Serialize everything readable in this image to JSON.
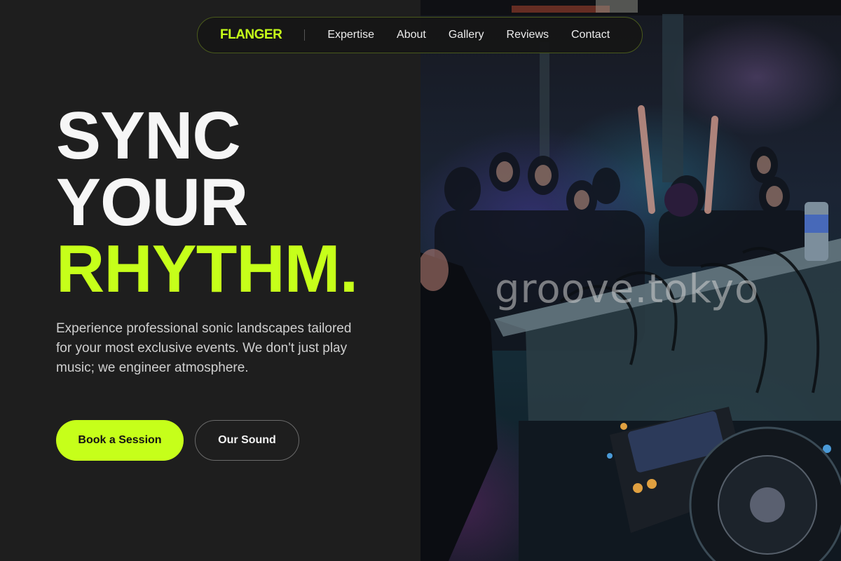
{
  "nav": {
    "brand": "FLANGER",
    "links": [
      "Expertise",
      "About",
      "Gallery",
      "Reviews",
      "Contact"
    ]
  },
  "hero": {
    "headline": [
      "SYNC",
      "YOUR",
      "RHYTHM."
    ],
    "subtitle": "Experience professional sonic landscapes tailored for your most exclusive events. We don't just play music; we engineer atmosphere.",
    "primary_button": "Book a Session",
    "secondary_button": "Our Sound",
    "image_watermark": "groove.tokyo"
  },
  "colors": {
    "accent": "#c6ff1a",
    "background": "#1e1e1e",
    "text": "#f4f4f4",
    "muted_text": "#cfcfcf"
  }
}
